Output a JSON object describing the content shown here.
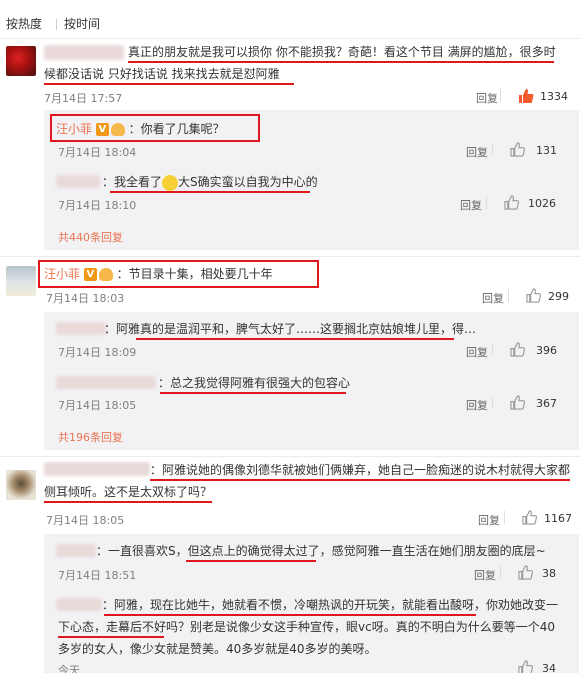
{
  "sort": {
    "by_hot": "按热度",
    "by_time": "按时间"
  },
  "c1": {
    "text1": "真正的朋友就是我可以损你 你不能损我？奇葩！看这个节目 满屏的尴尬，很多时",
    "text2": "候都没话说 只好找话说 找来找去就是怼阿雅",
    "time": "7月14日 17:57",
    "reply": "回复",
    "likes": "1334",
    "sub1": {
      "name": "汪小菲",
      "text": "：你看了几集呢？",
      "time": "7月14日 18:04",
      "reply": "回复",
      "likes": "131"
    },
    "sub2": {
      "text_a": "：我全看了",
      "text_b": "大S确实蛮以自我为中心的",
      "time": "7月14日 18:10",
      "reply": "回复",
      "likes": "1026"
    },
    "more": "共440条回复"
  },
  "c2": {
    "name": "汪小菲",
    "text": "：节目录十集，相处要几十年",
    "time": "7月14日 18:03",
    "reply": "回复",
    "likes": "299",
    "sub1": {
      "text": "：阿雅真的是温润平和，脾气太好了……这要搁北京姑娘堆儿里，得…",
      "time": "7月14日 18:09",
      "reply": "回复",
      "likes": "396"
    },
    "sub2": {
      "text": "：总之我觉得阿雅有很强大的包容心",
      "time": "7月14日 18:05",
      "reply": "回复",
      "likes": "367"
    },
    "more": "共196条回复"
  },
  "c3": {
    "text1": "：阿雅说她的偶像刘德华就被她们俩嫌弃，她自己一脸痴迷的说木村就得大家都",
    "text2": "侧耳倾听。这不是太双标了吗？",
    "time": "7月14日 18:05",
    "reply": "回复",
    "likes": "1167",
    "sub1": {
      "text": "：一直很喜欢S，但这点上的确觉得太过了，感觉阿雅一直生活在她们朋友圈的底层~",
      "time": "7月14日 18:51",
      "reply": "回复",
      "likes": "38"
    },
    "sub2": {
      "text1": "：阿雅，现在比她牛，她就看不惯，冷嘲热讽的开玩笑，就能看出酸呀，你劝她改变一",
      "text2": "下心态，走幕后不好吗？别老是说像少女这手种宣传，眼vc呀。真的不明白为什么要等一个40",
      "text3": "多岁的女人，像少女就是赞美。40多岁就是40多岁的美呀。",
      "time": "今天",
      "likes": "34"
    }
  },
  "colors": {
    "accent": "#eb7350",
    "highlight": "#e0171b",
    "vip": "#f09919",
    "sub_bg": "#f2f2f5"
  },
  "icons": {
    "like": "thumbs-up-icon",
    "like_hot": "thumbs-up-hot-icon",
    "vip": "vip-badge-icon",
    "emoji": "smiley-emoji-icon"
  }
}
